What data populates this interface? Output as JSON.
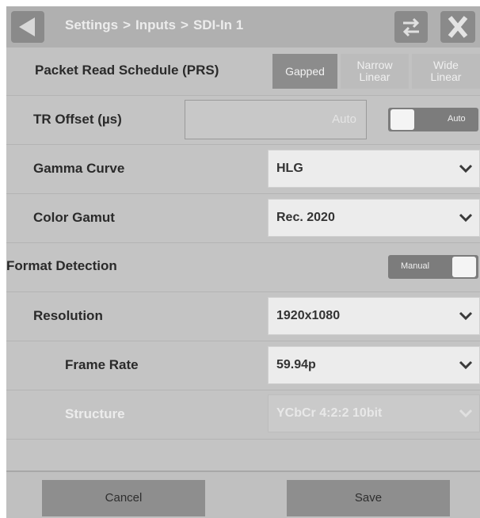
{
  "header": {
    "breadcrumb": [
      "Settings",
      "Inputs",
      "SDI-In 1"
    ],
    "separator": ">"
  },
  "prs": {
    "label": "Packet Read Schedule (PRS)",
    "options": [
      {
        "line1": "Gapped",
        "line2": "",
        "selected": true
      },
      {
        "line1": "Narrow",
        "line2": "Linear",
        "selected": false
      },
      {
        "line1": "Wide",
        "line2": "Linear",
        "selected": false
      }
    ]
  },
  "tr_offset": {
    "label": "TR Offset (µs)",
    "value_placeholder": "Auto",
    "toggle_label": "Auto"
  },
  "gamma": {
    "label": "Gamma Curve",
    "value": "HLG"
  },
  "gamut": {
    "label": "Color Gamut",
    "value": "Rec. 2020"
  },
  "format_detection": {
    "label": "Format Detection",
    "toggle_label": "Manual"
  },
  "resolution": {
    "label": "Resolution",
    "value": "1920x1080"
  },
  "frame_rate": {
    "label": "Frame Rate",
    "value": "59.94p"
  },
  "structure": {
    "label": "Structure",
    "value": "YCbCr 4:2:2 10bit",
    "enabled": false
  },
  "footer": {
    "cancel": "Cancel",
    "save": "Save"
  },
  "colors": {
    "panel_bg": "#c4c4c4",
    "header_bg": "#b0b0b0",
    "button_bg": "#8e8e8e",
    "dropdown_bg": "#ececec"
  }
}
